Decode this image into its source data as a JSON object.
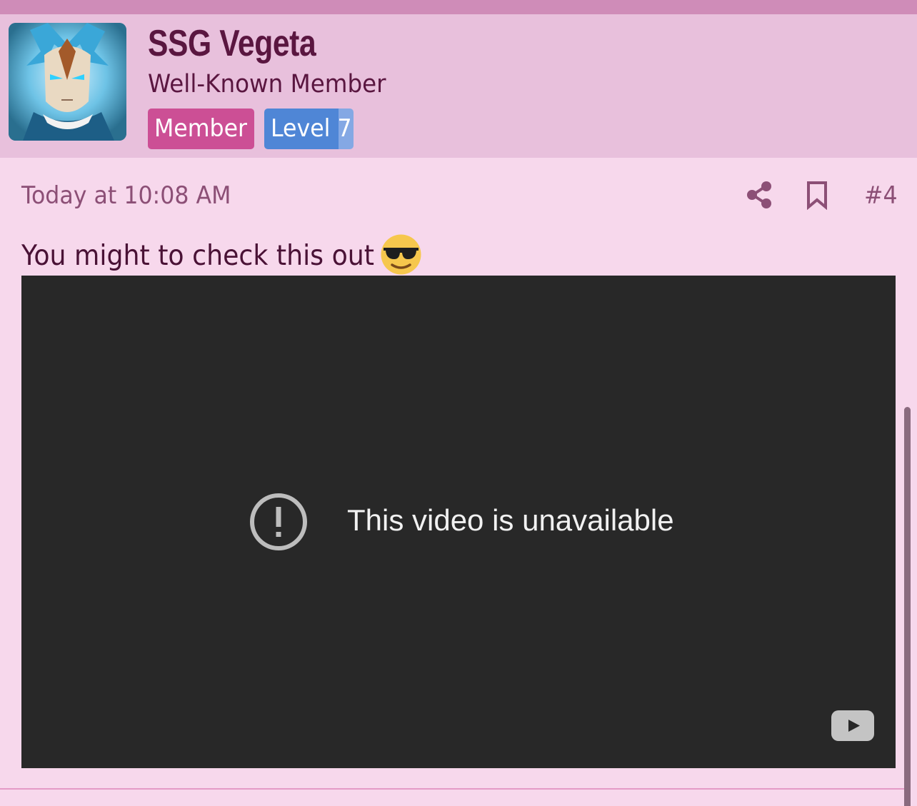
{
  "user": {
    "name": "SSG Vegeta",
    "title": "Well-Known Member",
    "avatar_icon": "vegeta-avatar",
    "badges": [
      {
        "label": "Member",
        "color": "#cc4f95"
      },
      {
        "label": "Level 7",
        "color": "#4f86d6"
      }
    ]
  },
  "post": {
    "timestamp": "Today at 10:08 AM",
    "number": "#4",
    "actions": {
      "share_icon": "share-icon",
      "bookmark_icon": "bookmark-icon"
    },
    "text": "You might to check this out",
    "emoji": "smiling-face-with-sunglasses"
  },
  "video": {
    "message": "This video is unavailable",
    "status_icon": "alert-circle-icon",
    "logo_icon": "youtube-icon"
  },
  "colors": {
    "page_background": "#f7d8ec",
    "header_background": "#e8c0dc",
    "accent_stripe": "#cf8cb8",
    "username": "#5a1640",
    "meta_text": "#8c4f76",
    "video_background": "#282828"
  }
}
